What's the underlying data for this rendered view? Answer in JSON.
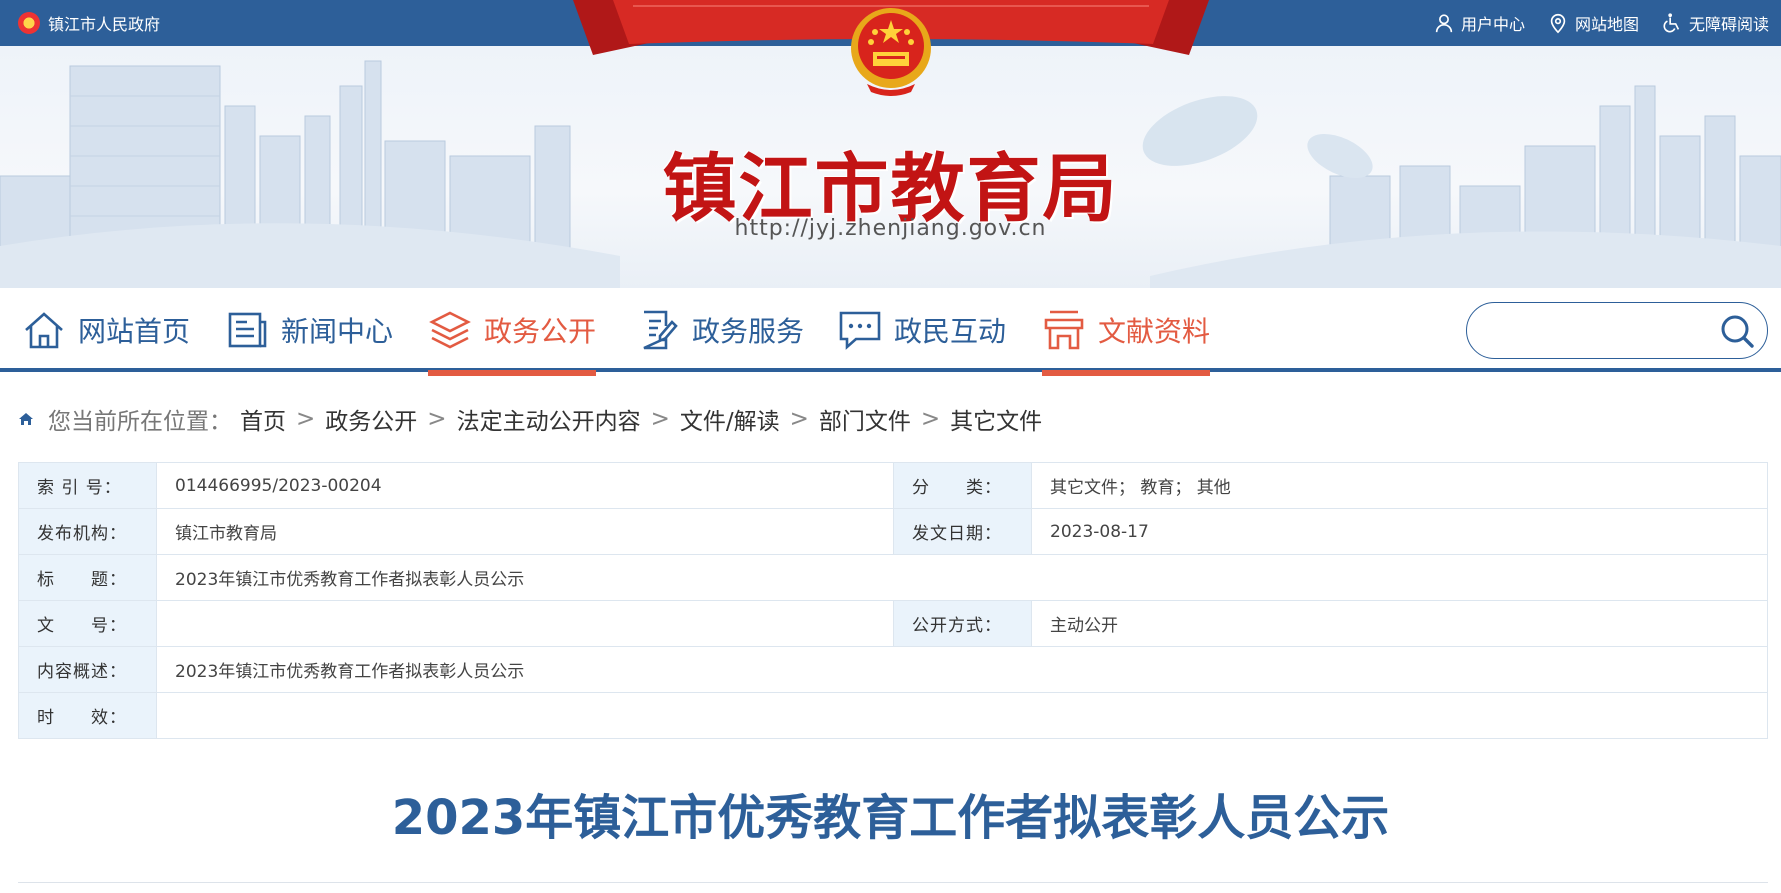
{
  "topbar": {
    "gov_label": "镇江市人民政府",
    "user_center": "用户中心",
    "site_map": "网站地图",
    "accessibility": "无障碍阅读"
  },
  "banner": {
    "title": "镇江市教育局",
    "url": "http://jyj.zhenjiang.gov.cn"
  },
  "nav": {
    "items": [
      {
        "label": "网站首页",
        "icon": "home-icon"
      },
      {
        "label": "新闻中心",
        "icon": "news-icon"
      },
      {
        "label": "政务公开",
        "icon": "layers-icon"
      },
      {
        "label": "政务服务",
        "icon": "document-edit-icon"
      },
      {
        "label": "政民互动",
        "icon": "chat-icon"
      },
      {
        "label": "文献资料",
        "icon": "archive-icon"
      }
    ],
    "active_index": 2,
    "search_placeholder": ""
  },
  "breadcrumb": {
    "prefix": "您当前所在位置：",
    "items": [
      "首页",
      "政务公开",
      "法定主动公开内容",
      "文件/解读",
      "部门文件",
      "其它文件"
    ]
  },
  "info": {
    "index_label": "索 引 号：",
    "index_value": "014466995/2023-00204",
    "category_label": "分　　类：",
    "category_value": "其它文件； 教育； 其他",
    "org_label": "发布机构：",
    "org_value": "镇江市教育局",
    "date_label": "发文日期：",
    "date_value": "2023-08-17",
    "title_label": "标　　题：",
    "title_value": "2023年镇江市优秀教育工作者拟表彰人员公示",
    "docno_label": "文　　号：",
    "docno_value": "",
    "method_label": "公开方式：",
    "method_value": "主动公开",
    "summary_label": "内容概述：",
    "summary_value": "2023年镇江市优秀教育工作者拟表彰人员公示",
    "validity_label": "时　　效：",
    "validity_value": ""
  },
  "article": {
    "title": "2023年镇江市优秀教育工作者拟表彰人员公示"
  },
  "colors": {
    "primary_blue": "#2d5f99",
    "accent_red": "#e35b42",
    "title_red": "#c21414",
    "table_key_bg": "#eaf3fb"
  }
}
